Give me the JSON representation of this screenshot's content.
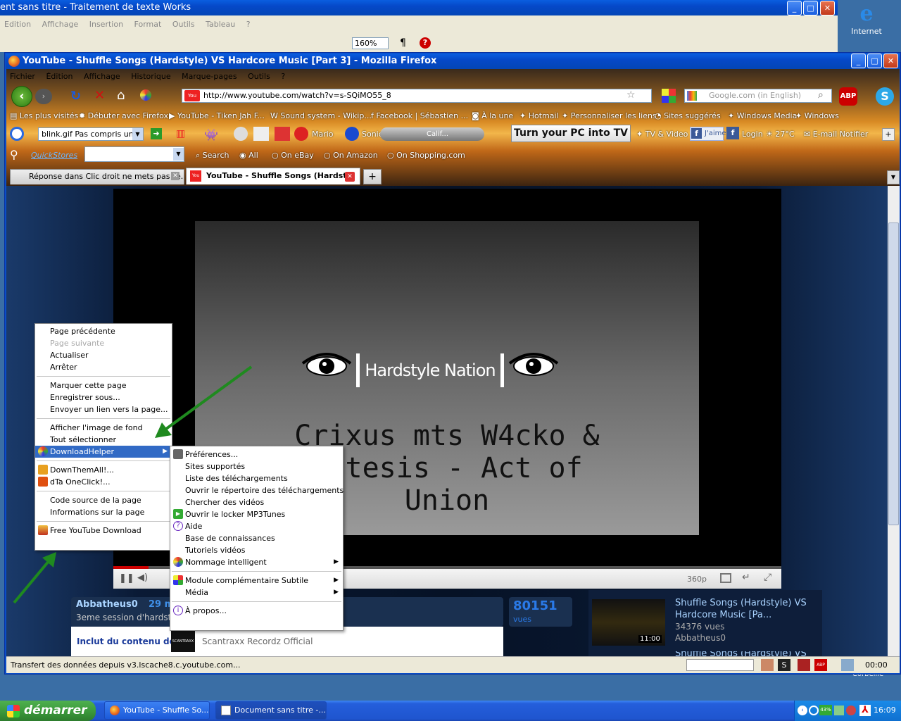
{
  "bg_window": {
    "title": "ent sans titre - Traitement de texte Works",
    "menu": [
      "Edition",
      "Affichage",
      "Insertion",
      "Format",
      "Outils",
      "Tableau",
      "?"
    ],
    "zoom": "160%",
    "para": "¶"
  },
  "desktop": {
    "internet_label": "Internet",
    "corbeille": "Corbeille"
  },
  "firefox": {
    "title": "YouTube - Shuffle Songs (Hardstyle) VS Hardcore Music [Part 3] - Mozilla Firefox",
    "menu": [
      "Fichier",
      "Édition",
      "Affichage",
      "Historique",
      "Marque-pages",
      "Outils",
      "?"
    ],
    "url": "http://www.youtube.com/watch?v=s-SQiMO55_8",
    "search_placeholder": "Google.com (in English)",
    "bookmarks": [
      "Les plus visités",
      "Débuter avec Firefox",
      "YouTube - Tiken Jah F...",
      "Sound system - Wikip...",
      "Facebook | Sébastien ...",
      "À la une",
      "Hotmail",
      "Personnaliser les liens",
      "Sites suggérés",
      "Windows Media",
      "Windows"
    ],
    "toolbar3": {
      "combo": "blink.gif Pas compris un mo",
      "mario": "Mario",
      "sonic": "Sonic",
      "radio": "Calif...",
      "tv_button": "Turn your PC into TV",
      "tv_video": "TV & Video",
      "jaime": "J'aime",
      "login": "Login",
      "temp": "27°C",
      "email": "E-mail Notifier"
    },
    "toolbar4": {
      "brand": "QuickStores",
      "search": "Search",
      "options": [
        "All",
        "On eBay",
        "On Amazon",
        "On Shopping.com"
      ]
    },
    "tabs": [
      {
        "label": "Réponse dans Clic droit ne mets pas \"e...",
        "active": false
      },
      {
        "label": "YouTube - Shuffle Songs (Hardst...",
        "active": true
      }
    ],
    "status": "Transfert des données depuis v3.lscache8.c.youtube.com...",
    "status_time": "00:00"
  },
  "video": {
    "logo_text": "Hardstyle Nation",
    "line1": "Crixus mts W4cko &",
    "line2": "Antesis - Act of",
    "line3": "Union",
    "quality": "360p"
  },
  "page": {
    "uploader": "Abbatheus0",
    "date": "29 m",
    "desc": "3eme session d'hardst",
    "views_count": "80151",
    "views_label": "vues",
    "content_label": "Inclut du contenu de :",
    "content_owner": "Scantraxx Recordz Official",
    "logo_label": "SCANTRAXX",
    "related": {
      "title": "Shuffle Songs (Hardstyle) VS Hardcore Music [Pa...",
      "views": "34376 vues",
      "author": "Abbatheus0",
      "duration": "11:00",
      "next": "Shuffle Songs (Hardstyle) VS"
    }
  },
  "context_menu": [
    "Page précédente",
    "Page suivante",
    "Actualiser",
    "Arrêter",
    "Marquer cette page",
    "Enregistrer sous...",
    "Envoyer un lien vers la page...",
    "Afficher l'image de fond",
    "Tout sélectionner",
    "DownloadHelper",
    "DownThemAll!...",
    "dTa OneClick!...",
    "Code source de la page",
    "Informations sur la page",
    "Free YouTube Download"
  ],
  "submenu": [
    "Préférences...",
    "Sites supportés",
    "Liste des téléchargements",
    "Ouvrir le répertoire des téléchargements",
    "Chercher des vidéos",
    "Ouvrir le locker MP3Tunes",
    "Aide",
    "Base de connaissances",
    "Tutoriels vidéos",
    "Nommage intelligent",
    "Module complémentaire Subtile",
    "Média",
    "À propos..."
  ],
  "taskbar": {
    "start": "démarrer",
    "items": [
      "YouTube - Shuffle So...",
      "Document sans titre -..."
    ],
    "clock": "16:09",
    "battery": "43%"
  },
  "colors": {
    "xp_blue": "#0548c8",
    "highlight": "#316ac5",
    "arrow": "#1f8a1f",
    "start_green": "#3c9b3c"
  }
}
